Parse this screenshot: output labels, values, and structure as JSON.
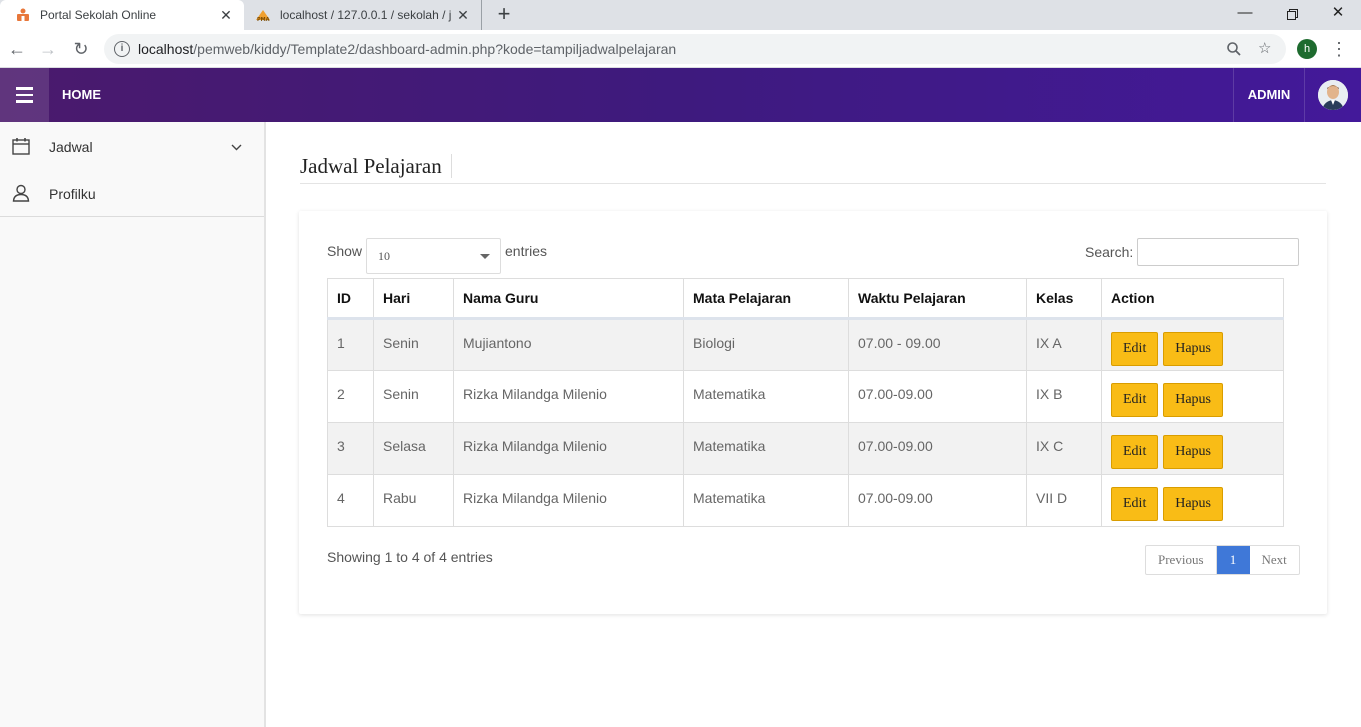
{
  "browser": {
    "tabs": [
      {
        "title": "Portal Sekolah Online",
        "active": true
      },
      {
        "title": "localhost / 127.0.0.1 / sekolah / ja",
        "active": false
      }
    ],
    "url_host": "localhost",
    "url_path": "/pemweb/kiddy/Template2/dashboard-admin.php?kode=tampiljadwalpelajaran",
    "profile_initial": "h"
  },
  "header": {
    "home_label": "HOME",
    "admin_label": "ADMIN"
  },
  "sidebar": {
    "items": [
      {
        "label": "Jadwal",
        "icon": "calendar-icon"
      },
      {
        "label": "Profilku",
        "icon": "user-icon"
      }
    ]
  },
  "page": {
    "title": "Jadwal Pelajaran"
  },
  "datatable": {
    "show_label": "Show",
    "page_length": "10",
    "entries_label": "entries",
    "search_label": "Search:",
    "search_value": "",
    "columns": [
      "ID",
      "Hari",
      "Nama Guru",
      "Mata Pelajaran",
      "Waktu Pelajaran",
      "Kelas",
      "Action"
    ],
    "rows": [
      {
        "id": "1",
        "hari": "Senin",
        "guru": "Mujiantono",
        "mapel": "Biologi",
        "waktu": "07.00 - 09.00",
        "kelas": "IX A"
      },
      {
        "id": "2",
        "hari": "Senin",
        "guru": "Rizka Milandga Milenio",
        "mapel": "Matematika",
        "waktu": "07.00-09.00",
        "kelas": "IX B"
      },
      {
        "id": "3",
        "hari": "Selasa",
        "guru": "Rizka Milandga Milenio",
        "mapel": "Matematika",
        "waktu": "07.00-09.00",
        "kelas": "IX C"
      },
      {
        "id": "4",
        "hari": "Rabu",
        "guru": "Rizka Milandga Milenio",
        "mapel": "Matematika",
        "waktu": "07.00-09.00",
        "kelas": "VII D"
      }
    ],
    "edit_label": "Edit",
    "delete_label": "Hapus",
    "info": "Showing 1 to 4 of 4 entries",
    "pagination": {
      "previous": "Previous",
      "current": "1",
      "next": "Next"
    }
  },
  "colors": {
    "header_gradient_start": "#4a1a6c",
    "header_gradient_end": "#43199a",
    "button_warning": "#f9bc16",
    "pagination_active": "#3f78d8"
  }
}
